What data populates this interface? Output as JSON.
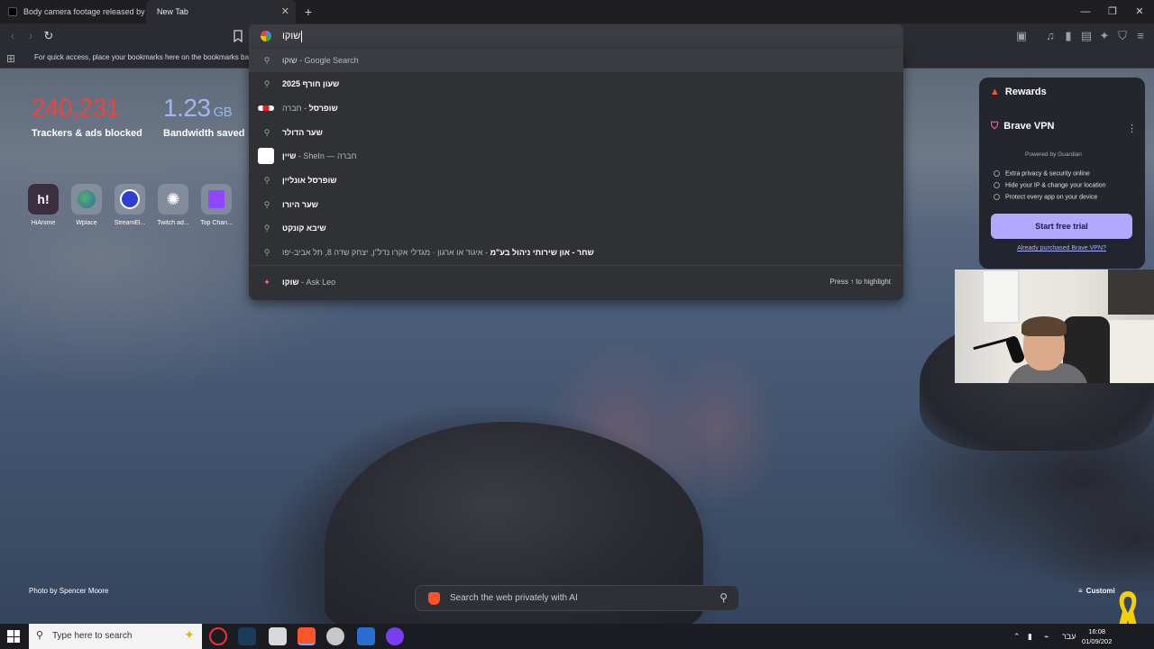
{
  "tabs": [
    {
      "title": "Body camera footage released by #F"
    },
    {
      "title": "New Tab"
    }
  ],
  "omnibox": {
    "text": "שוקו"
  },
  "bookmarks_bar": {
    "hint": "For quick access, place your bookmarks here on the bookmarks bar."
  },
  "suggestions": [
    {
      "bold": "שוקו",
      "rest": " - Google Search",
      "icon": "search-icon"
    },
    {
      "bold": "שעון חורף 2025",
      "rest": "",
      "icon": "search-icon"
    },
    {
      "bold": "שופרסל",
      "rest": " - חברה",
      "icon": "shufersal-logo"
    },
    {
      "bold": "שער הדולר",
      "rest": "",
      "icon": "search-icon"
    },
    {
      "bold": "שיין",
      "rest": " - SheIn — חברה",
      "icon": "shein-logo"
    },
    {
      "bold": "שופרסל אונליין",
      "rest": "",
      "icon": "search-icon"
    },
    {
      "bold": "שער היורו",
      "rest": "",
      "icon": "search-icon"
    },
    {
      "bold": "שיבא קונקט",
      "rest": "",
      "icon": "search-icon"
    },
    {
      "bold": "שחר - און שירותי ניהול בע\"מ",
      "rest": " - איגוד או ארגון · מגדלי אקרו נדל\"ן, יצחק שדה 8, תל אביב-יפו",
      "icon": "search-icon"
    },
    {
      "bold": "שוקו",
      "rest": " - Ask Leo",
      "icon": "leo-icon"
    }
  ],
  "press_hint": "Press ↑ to highlight",
  "stats": {
    "trackers_value": "240,231",
    "trackers_label": "Trackers & ads blocked",
    "bandwidth_value": "1.23",
    "bandwidth_unit": "GB",
    "bandwidth_label": "Bandwidth saved"
  },
  "top_sites": [
    {
      "label": "HiAnime",
      "icon": "hianime-icon"
    },
    {
      "label": "Wplace",
      "icon": "wplace-icon"
    },
    {
      "label": "StreamEl...",
      "icon": "streamelements-icon"
    },
    {
      "label": "Twitch ad...",
      "icon": "openai-icon"
    },
    {
      "label": "Top Chan...",
      "icon": "twitch-icon"
    }
  ],
  "widget": {
    "rewards": "Rewards",
    "vpn_title": "Brave VPN",
    "powered_by": "Powered by Guardian",
    "features": [
      "Extra privacy & security online",
      "Hide your IP & change your location",
      "Protect every app on your device"
    ],
    "trial_button": "Start free trial",
    "purchased_link": "Already purchased Brave VPN?"
  },
  "photo_credit": "Photo by Spencer Moore",
  "ai_search_placeholder": "Search the web privately with AI",
  "customize_label": "Customi",
  "taskbar": {
    "search_placeholder": "Type here to search",
    "language": "עבר",
    "time": "16:08",
    "date": "01/09/202"
  },
  "colors": {
    "trackers": "#e7453f",
    "bandwidth": "#9db7ee",
    "trial_button": "#b2a9ff"
  }
}
